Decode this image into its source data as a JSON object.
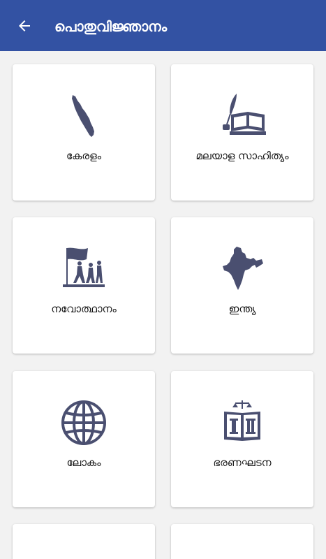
{
  "app": {
    "title": "പൊതുവിജ്ഞാനം"
  },
  "colors": {
    "appbar": "#3352a3",
    "icon": "#4a4f70",
    "background": "#f2f2f2"
  },
  "categories": [
    {
      "label": "കേരളം",
      "icon": "kerala-map-icon"
    },
    {
      "label": "മലയാള സാഹിത്യം",
      "icon": "quill-book-icon"
    },
    {
      "label": "നവോത്ഥാനം",
      "icon": "flag-march-icon"
    },
    {
      "label": "ഇന്ത്യ",
      "icon": "india-map-icon"
    },
    {
      "label": "ലോകം",
      "icon": "globe-icon"
    },
    {
      "label": "ഭരണഘടന",
      "icon": "scales-book-icon"
    }
  ]
}
